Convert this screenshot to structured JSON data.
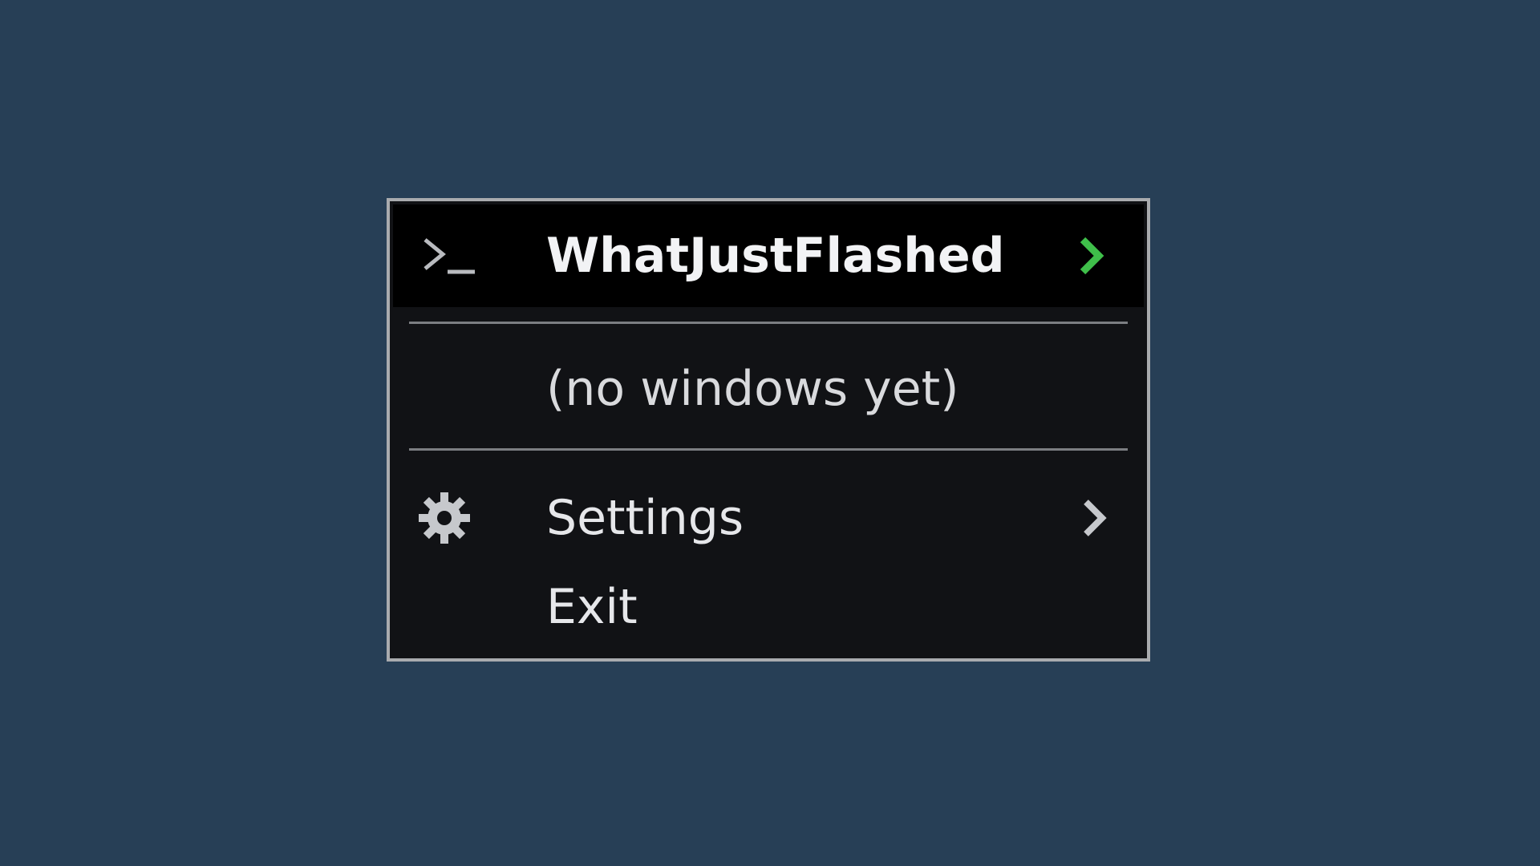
{
  "menu": {
    "header": {
      "title": "WhatJustFlashed",
      "icon": "terminal-prompt-icon",
      "chevron_icon": "chevron-right-icon",
      "chevron_color": "#3fbf4a"
    },
    "empty_state_label": "(no windows yet)",
    "items": [
      {
        "label": "Settings",
        "icon": "gear-icon",
        "has_submenu": true
      },
      {
        "label": "Exit"
      }
    ]
  },
  "colors": {
    "desktop_background": "#273f56",
    "menu_background": "#111215",
    "header_background": "#000000",
    "menu_border": "#a9abae",
    "separator": "#7c7e82"
  }
}
